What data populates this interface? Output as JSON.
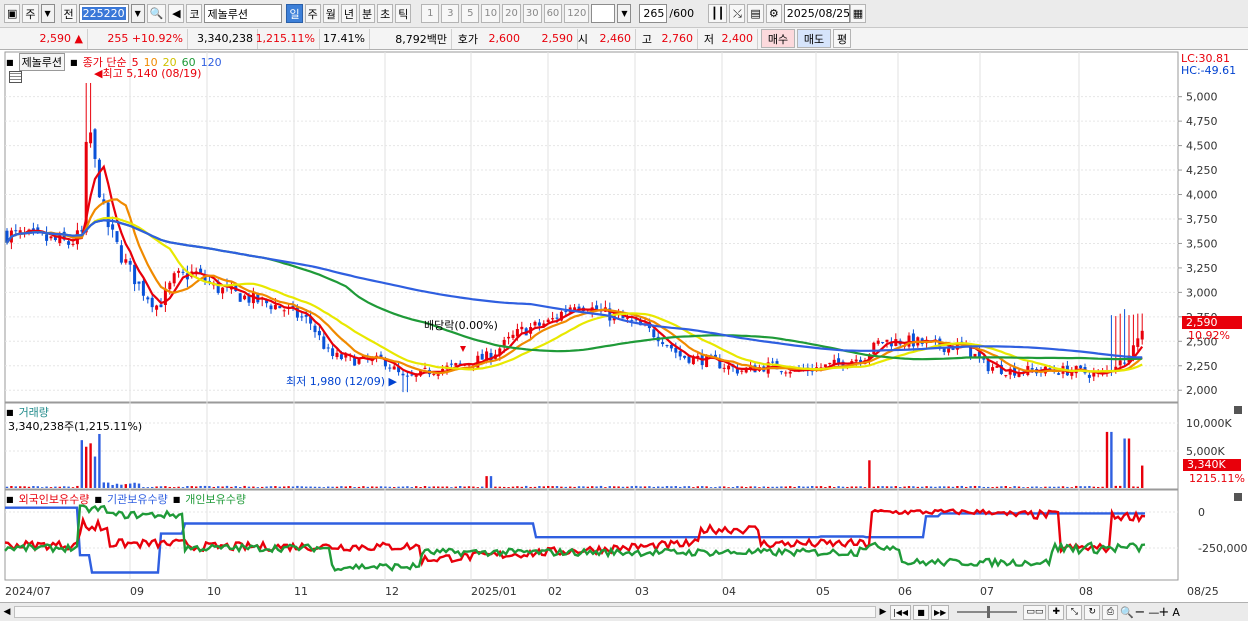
{
  "toolbar": {
    "market": "주",
    "prev": "전",
    "code": "225220",
    "view_label": "코",
    "stock_name": "제놀루션",
    "periods": [
      "일",
      "주",
      "월",
      "년",
      "분",
      "초",
      "틱"
    ],
    "selected_period": "일",
    "intervals": [
      "1",
      "3",
      "5",
      "10",
      "20",
      "30",
      "60",
      "120"
    ],
    "count": "265",
    "total": "/600",
    "date": "2025/08/25"
  },
  "quote": {
    "price": "2,590",
    "arrow": "▲",
    "change": "255",
    "change_pct": "+10.92%",
    "volume": "3,340,238",
    "volume_ratio": "1,215.11%",
    "turnover": "17.41%",
    "amount": "8,792백만",
    "quote_label": "호가",
    "ask": "2,600",
    "bid": "2,590",
    "open_label": "시",
    "open": "2,460",
    "high_label": "고",
    "high": "2,760",
    "low_label": "저",
    "low": "2,400",
    "buy_btn": "매수",
    "sell_btn": "매도",
    "eval_btn": "평"
  },
  "price_panel": {
    "name": "제놀루션",
    "legend_prefix": "종가 단순",
    "ma": [
      {
        "label": "5",
        "color": "#e8000b"
      },
      {
        "label": "10",
        "color": "#f08a00"
      },
      {
        "label": "20",
        "color": "#e8e800"
      },
      {
        "label": "60",
        "color": "#1f9a38"
      },
      {
        "label": "120",
        "color": "#2f5fe0"
      }
    ],
    "high_marker": "최고 5,140 (08/19)",
    "low_marker": "최저 1,980 (12/09)",
    "dividend_marker": "배당락(0.00%)",
    "lc": "LC:30.81",
    "hc": "HC:-49.61",
    "y_ticks": [
      "5,000",
      "4,750",
      "4,500",
      "4,250",
      "4,000",
      "3,750",
      "3,500",
      "3,250",
      "3,000",
      "2,750",
      "2,500",
      "2,250",
      "2,000"
    ],
    "current_price": "2,590",
    "current_pct": "10.92%"
  },
  "volume_panel": {
    "title": "거래량",
    "value": "3,340,238주(1,215.11%)",
    "y_ticks": [
      "10,000K",
      "5,000K"
    ],
    "current": "3,340K",
    "current_pct": "1215.11%"
  },
  "holding_panel": {
    "legend": [
      "외국인보유수량",
      "기관보유수량",
      "개인보유수량"
    ],
    "colors": [
      "#e8000b",
      "#2f5fe0",
      "#1f9a38"
    ],
    "y_ticks": [
      "0",
      "-250,000"
    ]
  },
  "x_axis": [
    "2024/07",
    "09",
    "10",
    "11",
    "12",
    "2025/01",
    "02",
    "03",
    "04",
    "05",
    "06",
    "07",
    "08",
    "08/25"
  ],
  "chart_data": {
    "type": "candlestick",
    "title": "제놀루션",
    "price_ylim": [
      1900,
      5150
    ],
    "price_high": 5140,
    "price_low": 1980,
    "months": [
      "2024/07",
      "2024/08",
      "2024/09",
      "2024/10",
      "2024/11",
      "2024/12",
      "2025/01",
      "2025/02",
      "2025/03",
      "2025/04",
      "2025/05",
      "2025/06",
      "2025/07",
      "2025/08"
    ],
    "approx_close_by_month": [
      3550,
      3500,
      2950,
      2850,
      2450,
      2250,
      2600,
      2800,
      2450,
      2250,
      2250,
      2550,
      2250,
      2590
    ],
    "ma120_approx": [
      3900,
      3700,
      3550,
      3300,
      3000,
      2800,
      2650,
      2550,
      2500,
      2400,
      2350,
      2350,
      2330,
      2300
    ]
  }
}
